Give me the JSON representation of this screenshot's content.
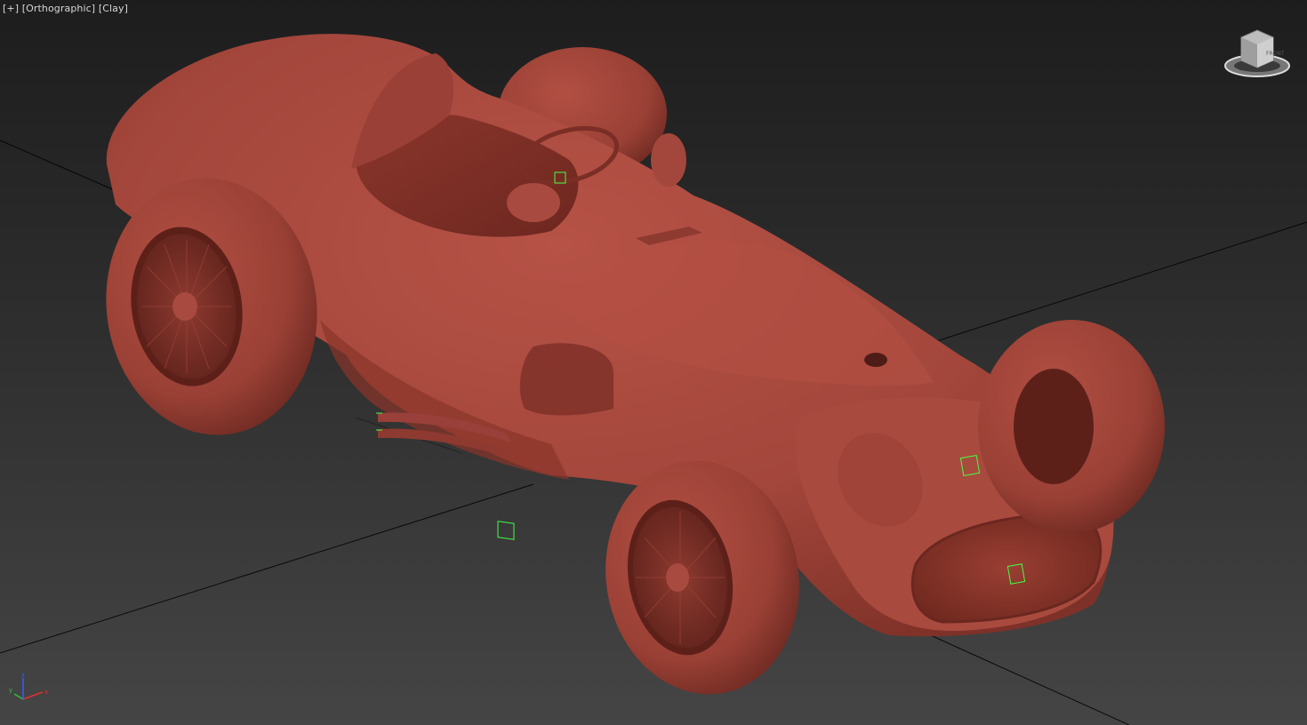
{
  "viewport": {
    "menu_plus": "[+]",
    "view_mode": "[Orthographic]",
    "shading": "[Clay]"
  },
  "viewcube": {
    "front_label": "FRONT",
    "top_label": "TOP"
  },
  "axis": {
    "x": "x",
    "y": "y",
    "z": "z"
  },
  "colors": {
    "clay": "#a9483e",
    "grid_line": "#000000",
    "helper_green": "#44ff44",
    "axis_x": "#e03030",
    "axis_y": "#30c030",
    "axis_z": "#3060ff"
  },
  "icons": [
    "viewcube-icon",
    "axis-tripod-icon"
  ]
}
